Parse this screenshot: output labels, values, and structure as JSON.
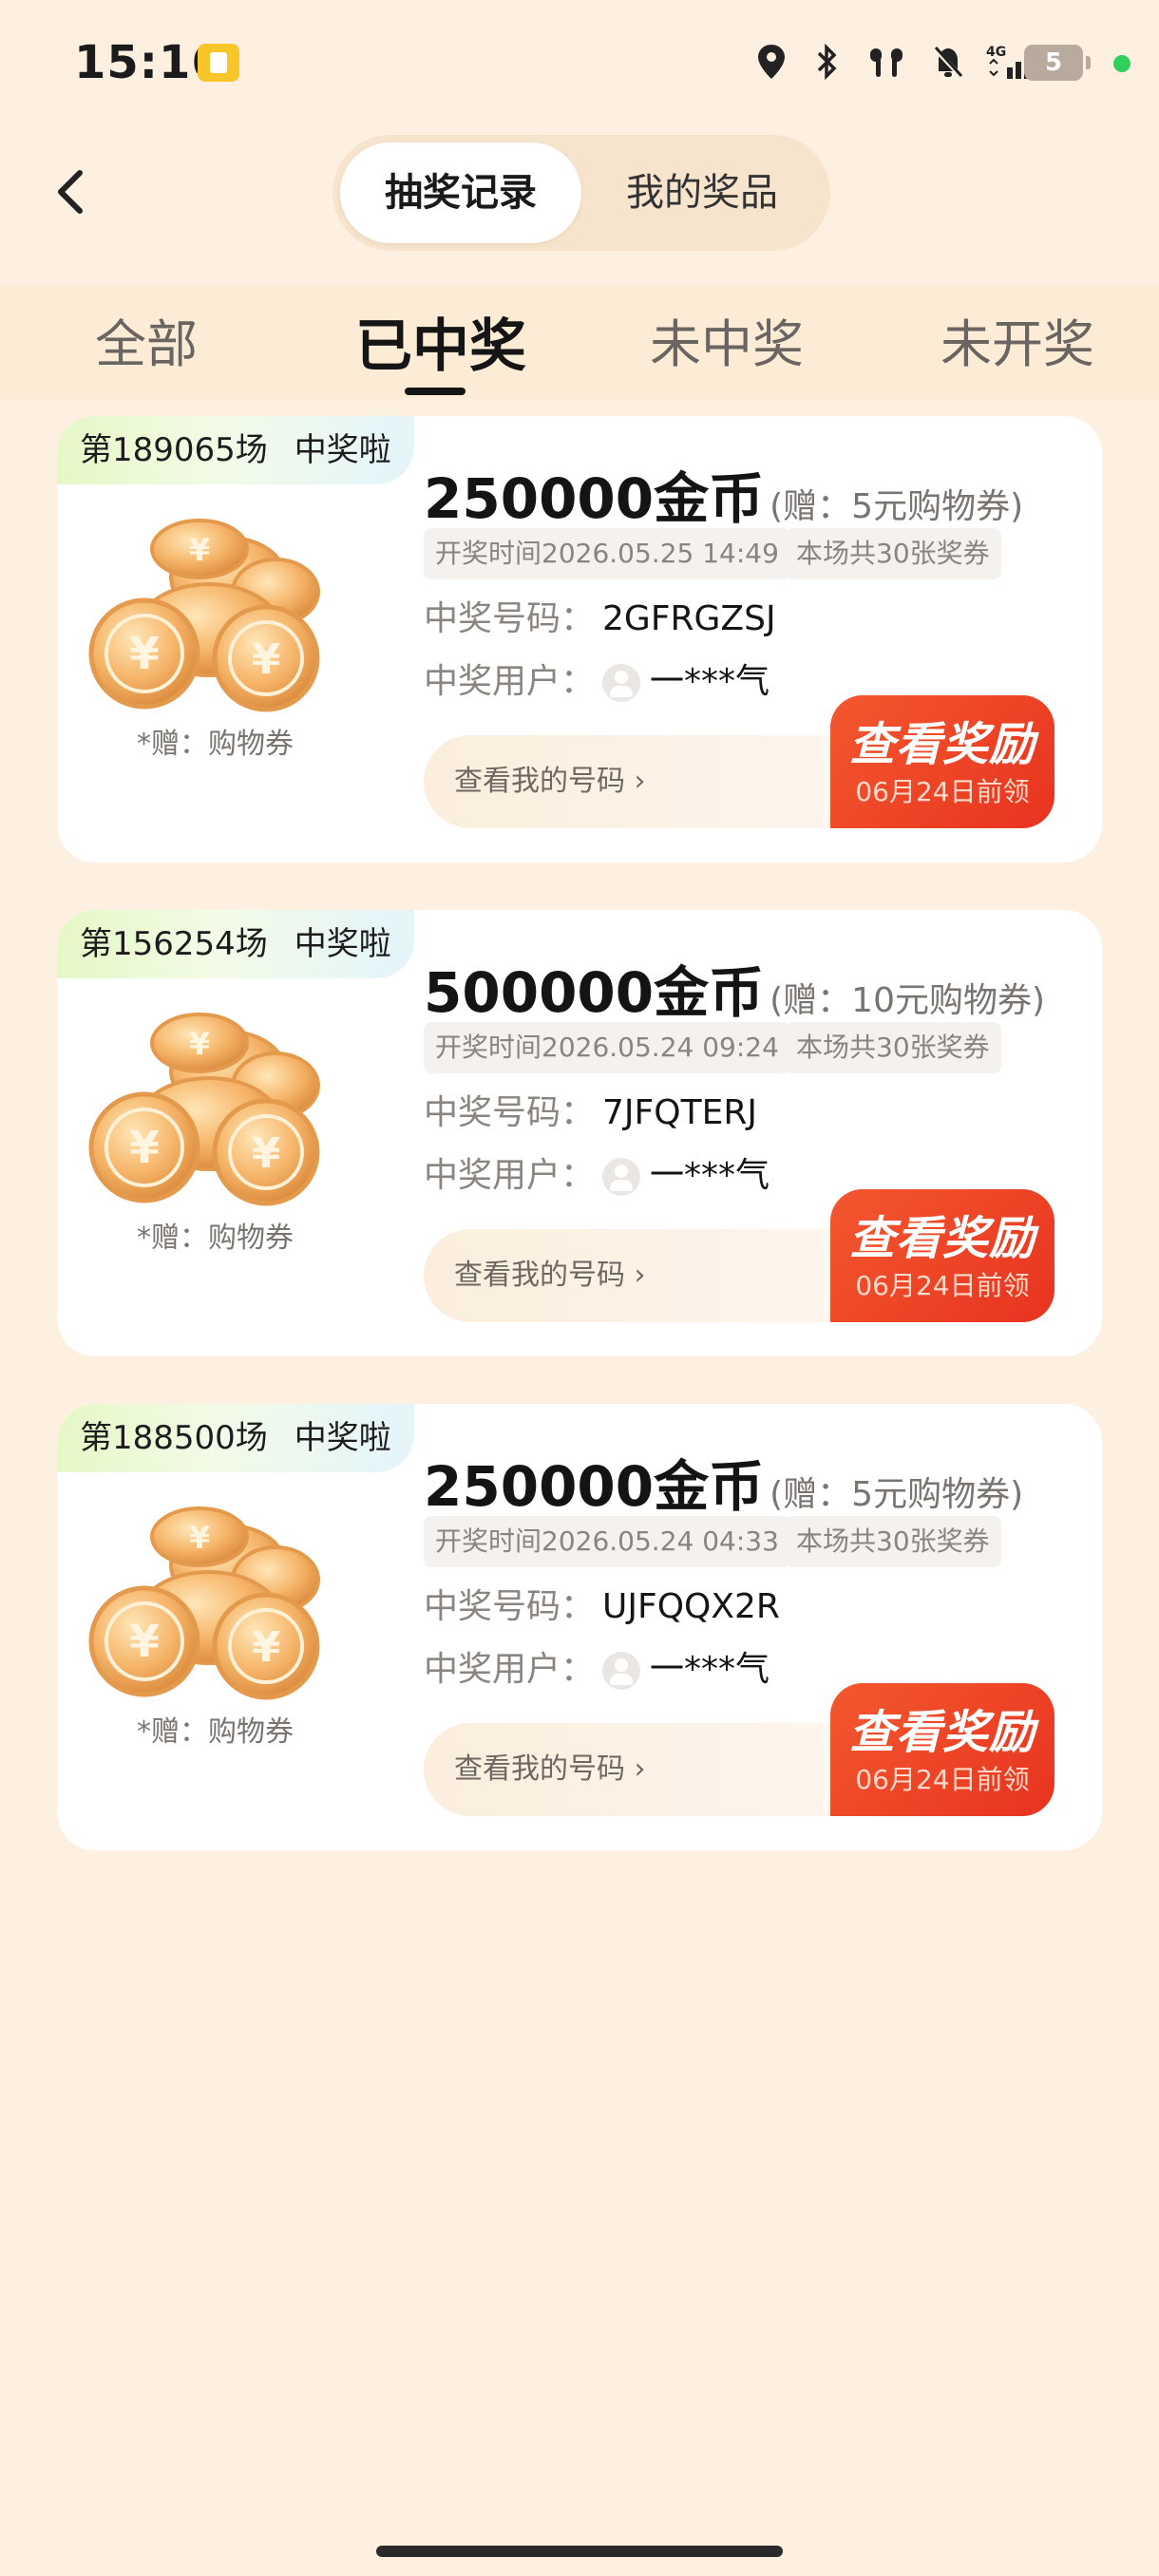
{
  "status": {
    "time": "15:16",
    "network": "4G",
    "battery": "5"
  },
  "header": {
    "segments": [
      "抽奖记录",
      "我的奖品"
    ]
  },
  "tabs": [
    "全部",
    "已中奖",
    "未中奖",
    "未开奖"
  ],
  "labels": {
    "win_code": "中奖号码：",
    "win_user": "中奖用户：",
    "view_my_code": "查看我的号码 ›",
    "view_reward": "查看奖励",
    "deadline": "06月24日前领",
    "gift_note": "*赠：购物券",
    "badge_suffix": "中奖啦"
  },
  "cards": [
    {
      "session": "第189065场",
      "amount": "250000金币",
      "gift": "(赠：5元购物券)",
      "draw_time": "开奖时间2026.05.25 14:49",
      "tickets": "本场共30张奖券",
      "code": "2GFRGZSJ",
      "user": "一***气"
    },
    {
      "session": "第156254场",
      "amount": "500000金币",
      "gift": "(赠：10元购物券)",
      "draw_time": "开奖时间2026.05.24 09:24",
      "tickets": "本场共30张奖券",
      "code": "7JFQTERJ",
      "user": "一***气"
    },
    {
      "session": "第188500场",
      "amount": "250000金币",
      "gift": "(赠：5元购物券)",
      "draw_time": "开奖时间2026.05.24 04:33",
      "tickets": "本场共30张奖券",
      "code": "UJFQQX2R",
      "user": "一***气"
    }
  ]
}
